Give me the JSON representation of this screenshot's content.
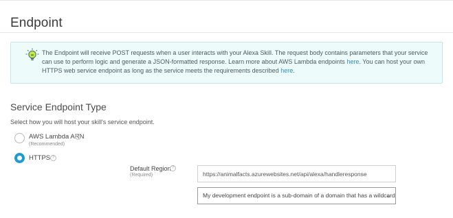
{
  "page": {
    "title": "Endpoint"
  },
  "info": {
    "text_1": "The Endpoint will receive POST requests when a user interacts with your Alexa Skill. The request body contains parameters that your service can use to perform logic",
    "text_2a": "and generate a JSON-formatted response. Learn more about AWS Lambda endpoints ",
    "link_1": "here",
    "text_2b": ". You can host your own HTTPS web service endpoint as long as the service",
    "text_3a": "meets the requirements described ",
    "link_2": "here",
    "text_3b": ".",
    "icon": "lightbulb-icon",
    "accent_color": "#2b8fc5"
  },
  "section": {
    "title": "Service Endpoint Type",
    "description": "Select how you will host your skill's service endpoint."
  },
  "options": {
    "lambda": {
      "label": "AWS Lambda ARN",
      "sub": "(Recommended)",
      "selected": false
    },
    "https": {
      "label": "HTTPS",
      "selected": true
    }
  },
  "region": {
    "label": "Default Region",
    "sub": "(Required)",
    "url_value": "https://animalfacts.azurewebsites.net/api/alexa/handleresponse",
    "cert_selected": "My development endpoint is a sub-domain of a domain that has a wildcard ..."
  },
  "colors": {
    "radio_selected": "#1a9bd8"
  }
}
